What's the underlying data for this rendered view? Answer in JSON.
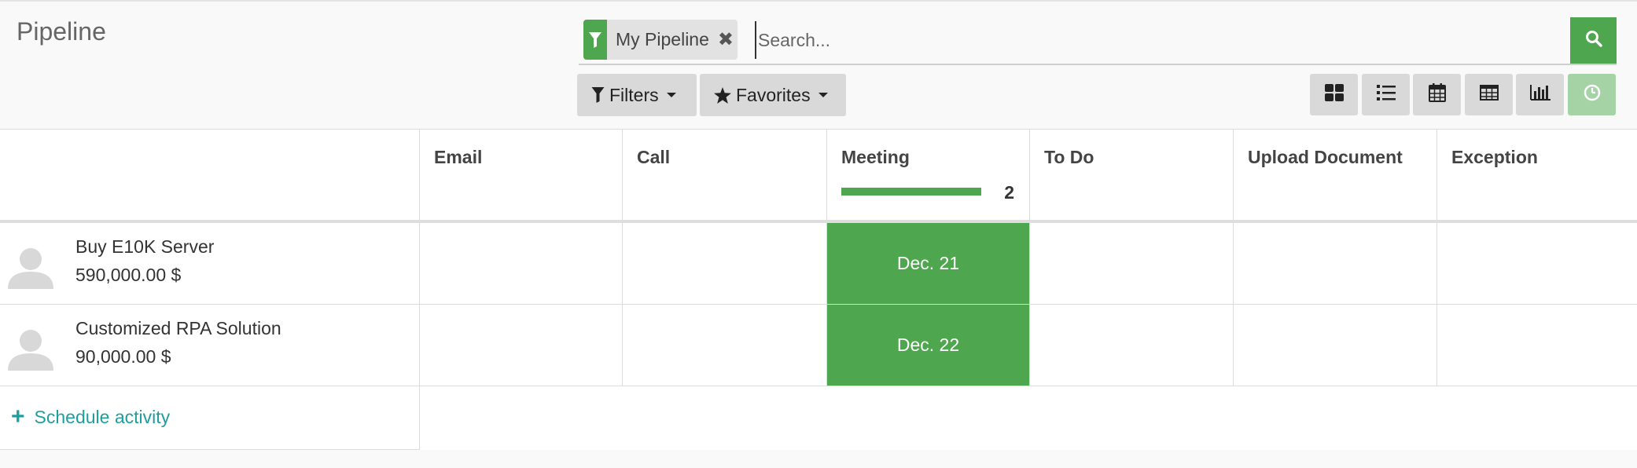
{
  "page": {
    "title": "Pipeline"
  },
  "search": {
    "facet_label": "My Pipeline",
    "facet_icon": "filter-icon",
    "placeholder": "Search...",
    "value": ""
  },
  "toolbar": {
    "filters_label": "Filters",
    "favorites_label": "Favorites",
    "views": [
      {
        "name": "kanban",
        "icon": "kanban-icon",
        "active": false
      },
      {
        "name": "list",
        "icon": "list-icon",
        "active": false
      },
      {
        "name": "calendar",
        "icon": "calendar-icon",
        "active": false
      },
      {
        "name": "pivot",
        "icon": "pivot-table-icon",
        "active": false
      },
      {
        "name": "graph",
        "icon": "bar-chart-icon",
        "active": false
      },
      {
        "name": "activity",
        "icon": "clock-icon",
        "active": true
      }
    ]
  },
  "activity_types": [
    {
      "label": "Email"
    },
    {
      "label": "Call"
    },
    {
      "label": "Meeting",
      "progress": 1.0,
      "count": "2"
    },
    {
      "label": "To Do"
    },
    {
      "label": "Upload Document"
    },
    {
      "label": "Exception"
    }
  ],
  "records": [
    {
      "name": "Buy E10K Server",
      "amount": "590,000.00 $",
      "activities": {
        "Meeting": "Dec. 21"
      }
    },
    {
      "name": "Customized RPA Solution",
      "amount": "90,000.00 $",
      "activities": {
        "Meeting": "Dec. 22"
      }
    }
  ],
  "footer": {
    "schedule_label": "Schedule activity"
  },
  "colors": {
    "accent": "#4ea64e",
    "link": "#1f9e9e",
    "active_view": "#a5d3a5"
  }
}
